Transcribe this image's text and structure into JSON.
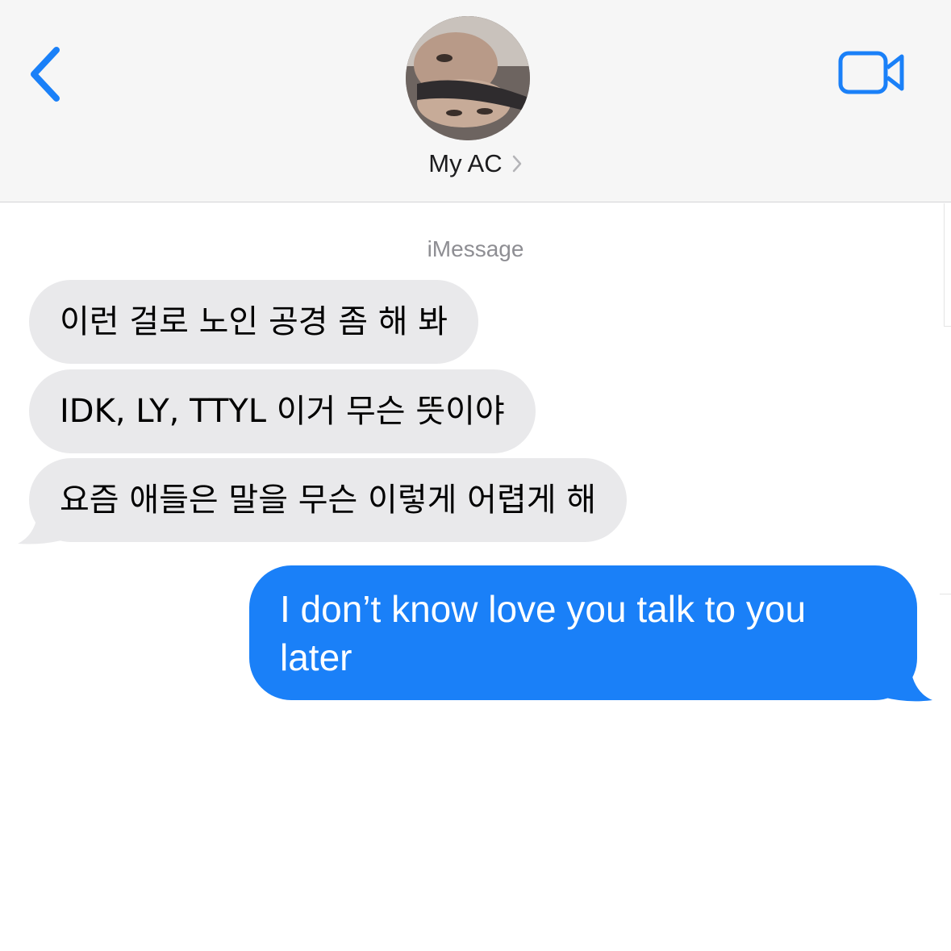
{
  "header": {
    "back_icon": "chevron-left-icon",
    "contact_name": "My AC",
    "chevron_icon": "chevron-right-icon",
    "video_icon": "video-camera-icon",
    "accent_color": "#1a80f8"
  },
  "conversation": {
    "service_label": "iMessage",
    "incoming": [
      {
        "text": "이런 걸로 노인 공경 좀 해 봐"
      },
      {
        "text": "IDK, LY, TTYL 이거 무슨 뜻이야"
      },
      {
        "text": "요즘 애들은 말을 무슨 이렇게 어렵게 해"
      }
    ],
    "outgoing": [
      {
        "text": "I don’t know love you talk to you later"
      }
    ]
  }
}
